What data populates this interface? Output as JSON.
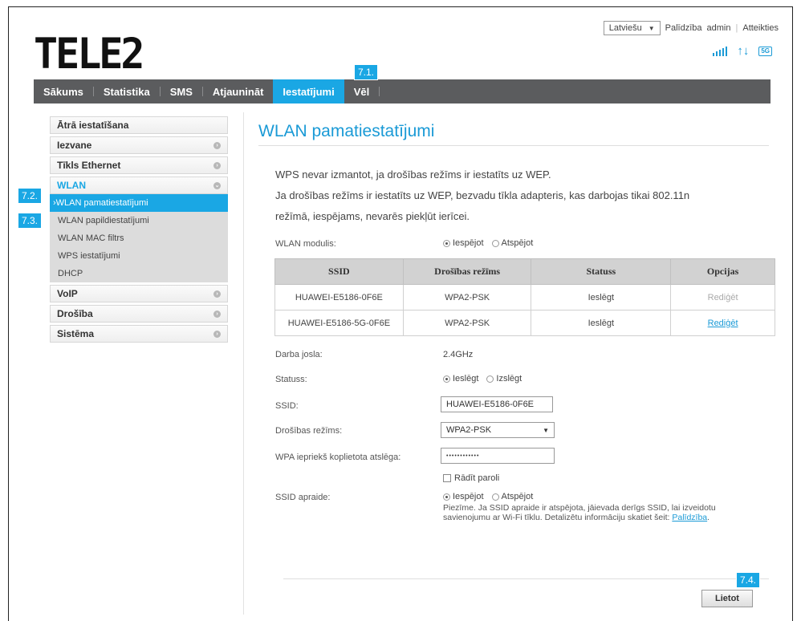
{
  "brand": {
    "logo_text": "TELE2",
    "accent": "#1aa7e4"
  },
  "header": {
    "language": "Latviešu",
    "help_link": "Palīdzība",
    "user": "admin",
    "logout_link": "Atteikties",
    "status_icons": [
      "signal-icon",
      "transfer-arrows-icon",
      "5g-icon"
    ],
    "badge_5g": "5G"
  },
  "nav": {
    "items": [
      {
        "label": "Sākums"
      },
      {
        "label": "Statistika"
      },
      {
        "label": "SMS"
      },
      {
        "label": "Atjaunināt"
      },
      {
        "label": "Iestatījumi",
        "active": true
      },
      {
        "label": "Vēl"
      }
    ]
  },
  "callouts": {
    "c1": "7.1.",
    "c2": "7.2.",
    "c3": "7.3.",
    "c4": "7.4."
  },
  "sidebar": {
    "items": [
      {
        "label": "Ātrā iestatīšana"
      },
      {
        "label": "Iezvane"
      },
      {
        "label": "Tīkls Ethernet"
      },
      {
        "label": "WLAN",
        "open": true
      },
      {
        "label": "VoIP"
      },
      {
        "label": "Drošība"
      },
      {
        "label": "Sistēma"
      }
    ],
    "wlan_sub": [
      {
        "label": "WLAN pamatiestatījumi",
        "active": true
      },
      {
        "label": "WLAN papildiestatījumi"
      },
      {
        "label": "WLAN MAC filtrs"
      },
      {
        "label": "WPS iestatījumi"
      },
      {
        "label": "DHCP"
      }
    ]
  },
  "main": {
    "title": "WLAN pamatiestatījumi",
    "info": [
      "WPS nevar izmantot, ja drošības režīms ir iestatīts uz WEP.",
      "Ja drošības režīms ir iestatīts uz WEP, bezvadu tīkla adapteris, kas darbojas tikai 802.11n",
      "režīmā, iespējams, nevarēs piekļūt ierīcei."
    ],
    "wlan_module": {
      "label": "WLAN modulis:",
      "opt_on": "Iespējot",
      "opt_off": "Atspējot",
      "selected": "on"
    },
    "table": {
      "headers": [
        "SSID",
        "Drošības režīms",
        "Statuss",
        "Opcijas"
      ],
      "rows": [
        {
          "ssid": "HUAWEI-E5186-0F6E",
          "security": "WPA2-PSK",
          "status": "Ieslēgt",
          "option": "Rediģēt"
        },
        {
          "ssid": "HUAWEI-E5186-5G-0F6E",
          "security": "WPA2-PSK",
          "status": "Ieslēgt",
          "option": "Rediģēt"
        }
      ]
    },
    "band": {
      "label": "Darba josla:",
      "value": "2.4GHz"
    },
    "status": {
      "label": "Statuss:",
      "opt_on": "Ieslēgt",
      "opt_off": "Izslēgt",
      "selected": "on"
    },
    "ssid": {
      "label": "SSID:",
      "value": "HUAWEI-E5186-0F6E"
    },
    "security_mode": {
      "label": "Drošības režīms:",
      "value": "WPA2-PSK"
    },
    "wpa_key": {
      "label": "WPA iepriekš koplietota atslēga:",
      "value": "••••••••••••"
    },
    "show_password": {
      "label": "Rādīt paroli",
      "checked": false
    },
    "ssid_broadcast": {
      "label": "SSID apraide:",
      "opt_on": "Iespējot",
      "opt_off": "Atspējot",
      "selected": "on"
    },
    "note_text": "Piezīme. Ja SSID apraide ir atspējota, jāievada derīgs SSID, lai izveidotu savienojumu ar Wi-Fi tīklu. Detalizētu informāciju skatiet šeit:",
    "note_link": "Palīdzība",
    "apply_label": "Lietot"
  }
}
